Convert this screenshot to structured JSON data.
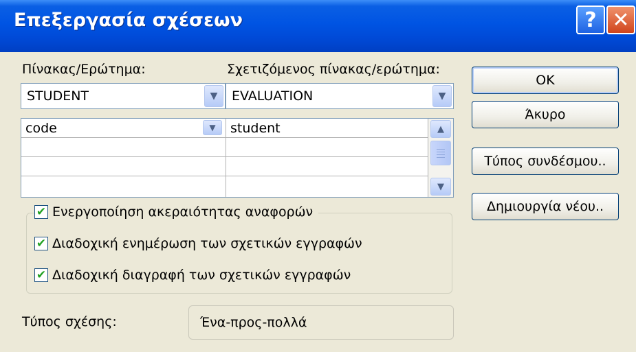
{
  "window": {
    "title": "Επεξεργασία σχέσεων",
    "help_label": "?",
    "close_label": "✕"
  },
  "table": {
    "label": "Πίνακας/Ερώτημα:",
    "value": "STUDENT"
  },
  "related_table": {
    "label": "Σχετιζόμενος πίνακας/ερώτημα:",
    "value": "EVALUATION"
  },
  "fields": {
    "rows": [
      {
        "left": "code",
        "right": "student"
      },
      {
        "left": "",
        "right": ""
      },
      {
        "left": "",
        "right": ""
      },
      {
        "left": "",
        "right": ""
      }
    ]
  },
  "options": {
    "enforce_integrity": {
      "label": "Ενεργοποίηση ακεραιότητας αναφορών",
      "checked": true
    },
    "cascade_update": {
      "label": "Διαδοχική ενημέρωση των σχετικών εγγραφών",
      "checked": true
    },
    "cascade_delete": {
      "label": "Διαδοχική διαγραφή των σχετικών εγγραφών",
      "checked": true
    }
  },
  "relationship_type": {
    "label": "Τύπος σχέσης:",
    "value": "Ένα-προς-πολλά"
  },
  "buttons": {
    "ok": "OK",
    "cancel": "Άκυρο",
    "join_type": "Τύπος συνδέσμου..",
    "create_new": "Δημιουργία νέου.."
  },
  "icons": {
    "dropdown": "chevron-down-icon",
    "scroll_up": "arrow-up-icon",
    "scroll_down": "arrow-down-icon",
    "check": "check-icon"
  },
  "colors": {
    "title_bar": "#0054e3",
    "close_button": "#d0451c",
    "checkmark": "#21a121"
  }
}
